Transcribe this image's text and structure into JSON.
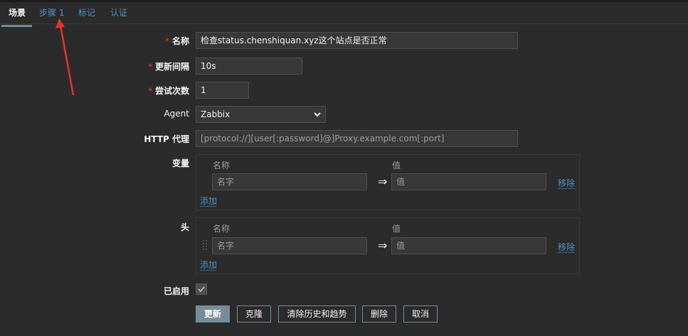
{
  "tabs": [
    {
      "label": "场景",
      "active": true
    },
    {
      "label": "步骤",
      "count": "1"
    },
    {
      "label": "标记"
    },
    {
      "label": "认证"
    }
  ],
  "form": {
    "name": {
      "label": "名称",
      "required": true,
      "value": "检查status.chenshiquan.xyz这个站点是否正常"
    },
    "interval": {
      "label": "更新间隔",
      "required": true,
      "value": "10s"
    },
    "attempts": {
      "label": "尝试次数",
      "required": true,
      "value": "1"
    },
    "agent": {
      "label": "Agent",
      "value": "Zabbix"
    },
    "proxy": {
      "label": "HTTP 代理",
      "placeholder": "[protocol://][user[:password]@]Proxy.example.com[:port]"
    },
    "variables": {
      "label": "变量",
      "col_name": "名称",
      "col_value": "值",
      "row_name_placeholder": "名字",
      "row_value_placeholder": "值",
      "arrow": "⇒",
      "remove": "移除",
      "add": "添加"
    },
    "headers": {
      "label": "头",
      "col_name": "名称",
      "col_value": "值",
      "row_name_placeholder": "名字",
      "row_value_placeholder": "值",
      "arrow": "⇒",
      "remove": "移除",
      "add": "添加"
    },
    "enabled": {
      "label": "已启用",
      "checked": true
    }
  },
  "buttons": {
    "update": "更新",
    "clone": "克隆",
    "clear": "清除历史和趋势",
    "delete": "删除",
    "cancel": "取消"
  },
  "colors": {
    "accent": "#768d99",
    "link": "#4796c4",
    "required": "#e33734",
    "annotation_arrow": "#e8322b"
  }
}
